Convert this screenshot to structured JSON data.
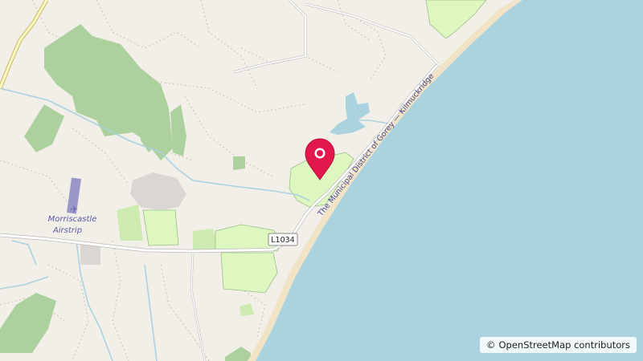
{
  "map": {
    "colors": {
      "land": "#f2efe9",
      "sea": "#aad3df",
      "beach": "#f1e3c6",
      "wood": "#add19e",
      "grass": "#cdebb0",
      "residential": "#e0dfdf",
      "campsite": "#def6c0",
      "road_casing": "#bbbbbb",
      "marker": "#e2184d"
    },
    "labels": {
      "airstrip": "Morriscastle Airstrip",
      "airstrip_line1": "Morriscastle",
      "airstrip_line2": "Airstrip",
      "road_ref": "L1034",
      "coast_road": "The Municipal District of Gorey — Kilmuckridge"
    },
    "icons": {
      "airport": "airplane-icon",
      "marker": "location-pin-icon"
    },
    "attribution": {
      "symbol": "©",
      "text": "OpenStreetMap contributors"
    }
  }
}
